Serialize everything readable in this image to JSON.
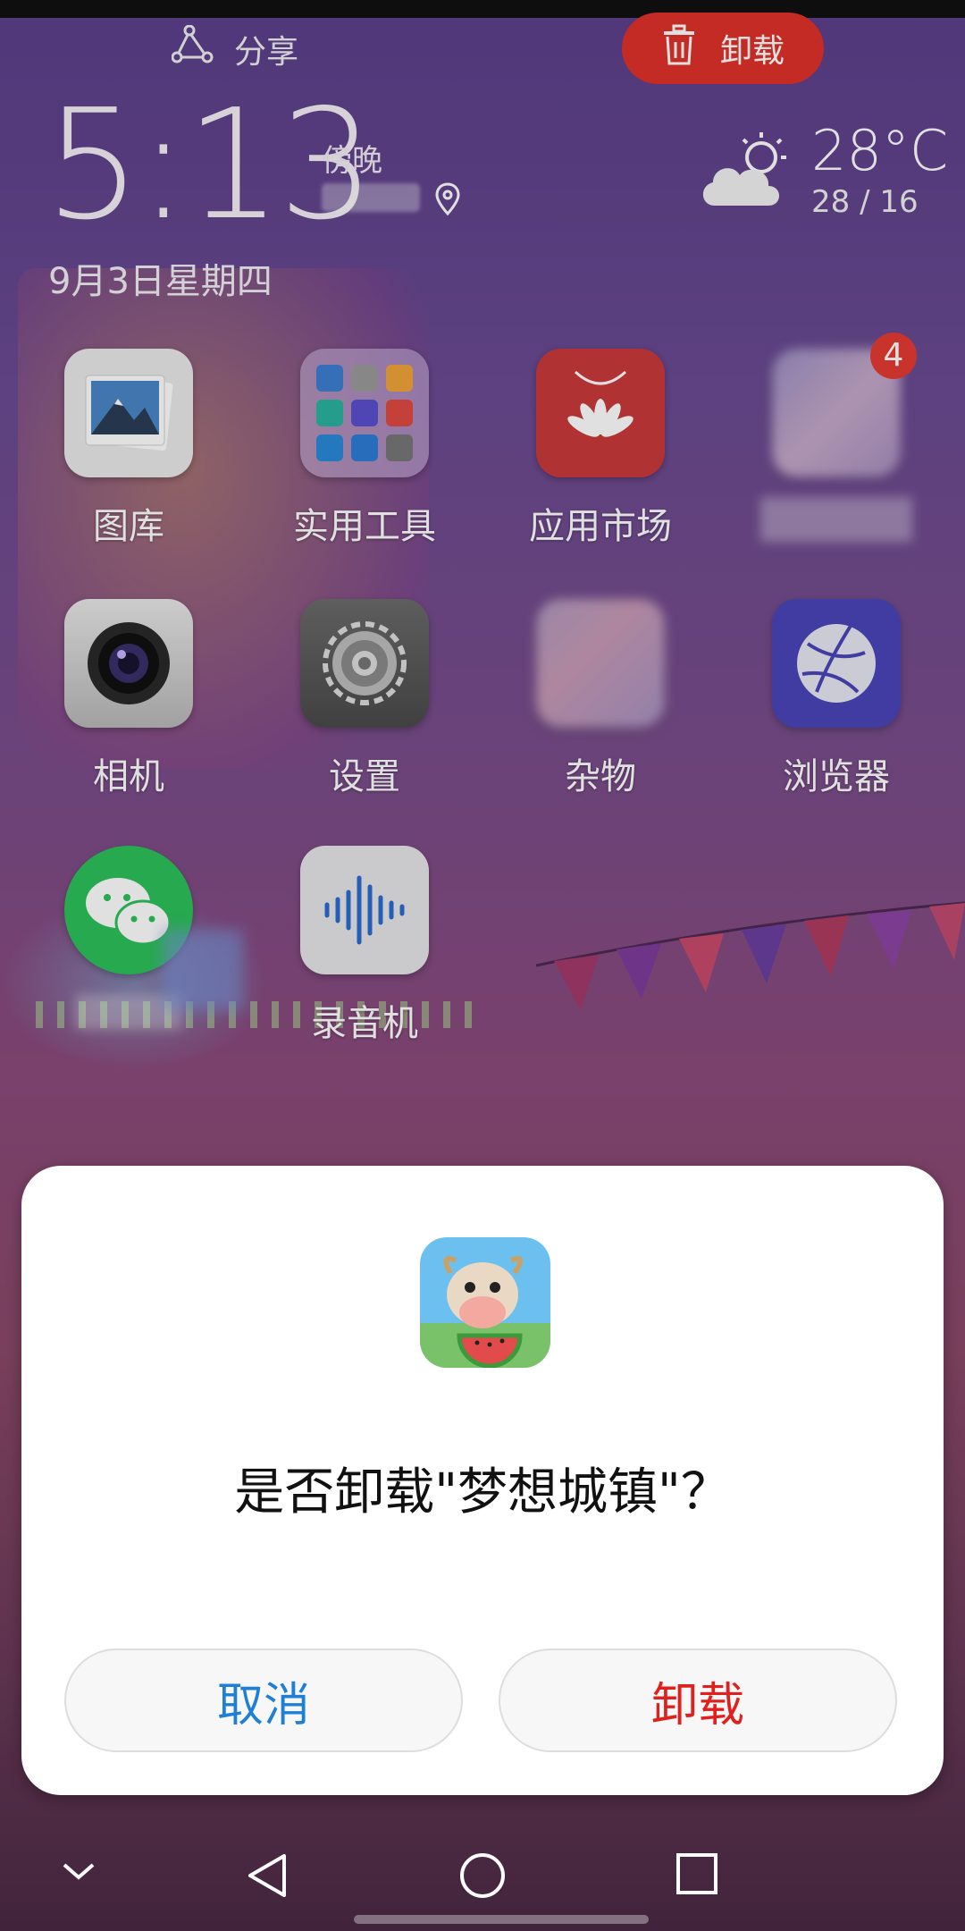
{
  "topbar": {
    "share_label": "分享",
    "uninstall_label": "卸载",
    "uninstall_color": "#e0312a"
  },
  "clock": {
    "time": "5:13",
    "period": "傍晚",
    "date": "9月3日星期四"
  },
  "weather": {
    "temp": "28°C",
    "range": "28 / 16",
    "icon": "partly-cloudy-icon"
  },
  "apps": [
    {
      "label": "图库",
      "icon": "gallery-icon"
    },
    {
      "label": "实用工具",
      "icon": "tools-folder-icon"
    },
    {
      "label": "应用市场",
      "icon": "app-market-icon"
    },
    {
      "label": "",
      "icon": "blurred-folder-icon",
      "badge": "4"
    },
    {
      "label": "相机",
      "icon": "camera-icon"
    },
    {
      "label": "设置",
      "icon": "settings-gear-icon"
    },
    {
      "label": "杂物",
      "icon": "misc-folder-icon"
    },
    {
      "label": "浏览器",
      "icon": "browser-icon"
    },
    {
      "label": "",
      "icon": "wechat-icon"
    },
    {
      "label": "录音机",
      "icon": "recorder-icon"
    }
  ],
  "dialog": {
    "message": "是否卸载\"梦想城镇\"？",
    "app_icon": "township-app-icon",
    "cancel_label": "取消",
    "confirm_label": "卸载",
    "cancel_color": "#1f7fd4",
    "confirm_color": "#e0201c"
  },
  "navbar": {
    "items": [
      "collapse-chevron-icon",
      "back-triangle-icon",
      "home-circle-icon",
      "recents-square-icon"
    ]
  }
}
